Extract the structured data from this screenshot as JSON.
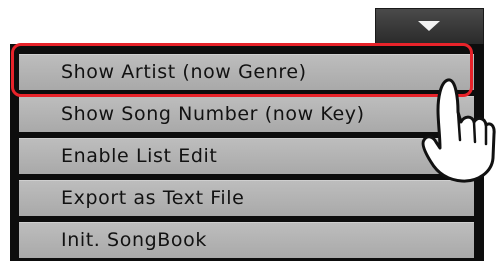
{
  "menu": {
    "items": [
      {
        "label": "Show Artist (now Genre)"
      },
      {
        "label": "Show Song Number (now Key)"
      },
      {
        "label": "Enable List Edit"
      },
      {
        "label": "Export as Text File"
      },
      {
        "label": "Init. SongBook"
      }
    ],
    "highlighted_index": 0
  },
  "icons": {
    "dropdown": "triangle-down-icon",
    "pointer": "hand-pointer-icon"
  },
  "colors": {
    "item_bg": "#b3b3b3",
    "panel_bg": "#0d0d0d",
    "highlight": "#e8232a"
  }
}
